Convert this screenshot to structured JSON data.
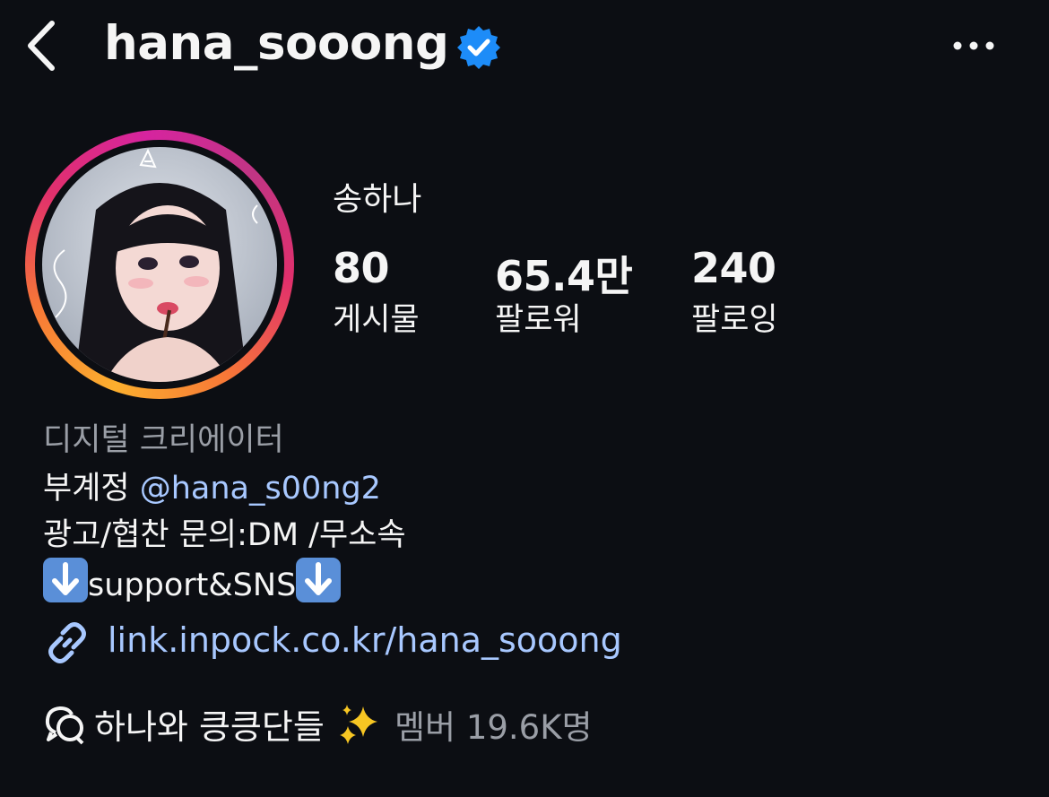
{
  "header": {
    "username": "hana_sooong",
    "back_icon": "chevron-left-icon",
    "verified_icon": "verified-badge-icon",
    "more_icon": "more-horizontal-icon"
  },
  "profile": {
    "display_name": "송하나",
    "stats": [
      {
        "value": "80",
        "label": "게시물"
      },
      {
        "value": "65.4만",
        "label": "팔로워"
      },
      {
        "value": "240",
        "label": "팔로잉"
      }
    ]
  },
  "bio": {
    "category": "디지털 크리에이터",
    "line1_prefix": "부계정 ",
    "line1_mention": "@hana_s00ng2",
    "line2": "광고/협찬 문의:DM /무소속",
    "line3": "support&SNS"
  },
  "link": {
    "text": "link.inpock.co.kr/hana_sooong",
    "icon": "link-icon"
  },
  "channel": {
    "name": "하나와 킁킁단들",
    "members": "멤버 19.6K명",
    "icon": "broadcast-channel-icon"
  },
  "colors": {
    "background": "#0c0e13",
    "link": "#a8c8ff",
    "muted": "#9a9ea6",
    "verified": "#1d8cf8"
  }
}
